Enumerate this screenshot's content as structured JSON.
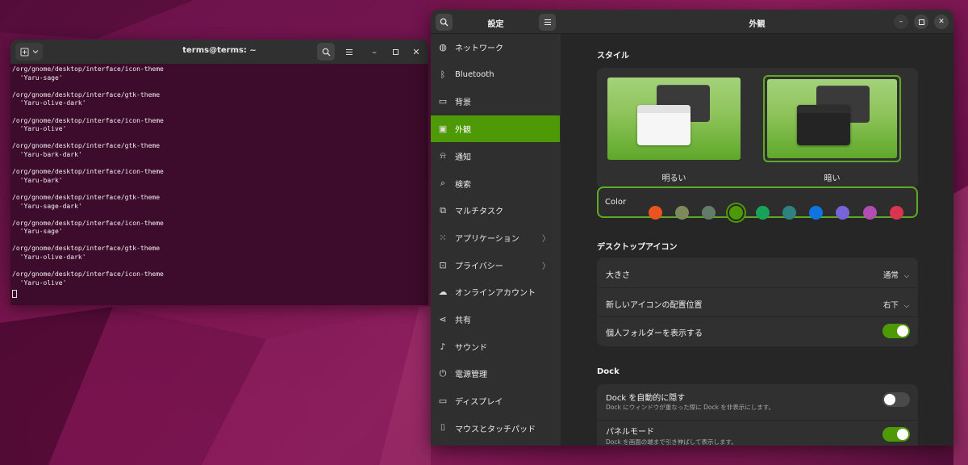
{
  "terminal": {
    "title": "terms@terms: ~",
    "lines": [
      "/org/gnome/desktop/interface/icon-theme",
      "  'Yaru-sage'",
      "",
      "/org/gnome/desktop/interface/gtk-theme",
      "  'Yaru-olive-dark'",
      "",
      "/org/gnome/desktop/interface/icon-theme",
      "  'Yaru-olive'",
      "",
      "/org/gnome/desktop/interface/gtk-theme",
      "  'Yaru-bark-dark'",
      "",
      "/org/gnome/desktop/interface/icon-theme",
      "  'Yaru-bark'",
      "",
      "/org/gnome/desktop/interface/gtk-theme",
      "  'Yaru-sage-dark'",
      "",
      "/org/gnome/desktop/interface/icon-theme",
      "  'Yaru-sage'",
      "",
      "/org/gnome/desktop/interface/gtk-theme",
      "  'Yaru-olive-dark'",
      "",
      "/org/gnome/desktop/interface/icon-theme",
      "  'Yaru-olive'"
    ]
  },
  "settings": {
    "sidebar_title": "設定",
    "page_title": "外観",
    "sidebar": [
      {
        "label": "ネットワーク",
        "icon": "network-icon"
      },
      {
        "label": "Bluetooth",
        "icon": "bluetooth-icon"
      },
      {
        "label": "背景",
        "icon": "background-icon"
      },
      {
        "label": "外観",
        "icon": "appearance-icon",
        "active": true
      },
      {
        "label": "通知",
        "icon": "bell-icon"
      },
      {
        "label": "検索",
        "icon": "search-icon"
      },
      {
        "label": "マルチタスク",
        "icon": "multitasking-icon"
      },
      {
        "label": "アプリケーション",
        "icon": "apps-grid-icon",
        "chevron": true
      },
      {
        "label": "プライバシー",
        "icon": "lock-icon",
        "chevron": true
      },
      {
        "label": "オンラインアカウント",
        "icon": "cloud-icon"
      },
      {
        "label": "共有",
        "icon": "share-icon"
      },
      {
        "label": "サウンド",
        "icon": "music-note-icon"
      },
      {
        "label": "電源管理",
        "icon": "power-icon"
      },
      {
        "label": "ディスプレイ",
        "icon": "display-icon"
      },
      {
        "label": "マウスとタッチパッド",
        "icon": "mouse-icon"
      }
    ],
    "style": {
      "heading": "スタイル",
      "light_label": "明るい",
      "dark_label": "暗い",
      "selected": "dark"
    },
    "color": {
      "label": "Color",
      "swatches": [
        "#e95420",
        "#7e8a5c",
        "#657b69",
        "#4e9a06",
        "#18a35a",
        "#308280",
        "#0f73e0",
        "#7764d8",
        "#b34cb3",
        "#da3450"
      ],
      "selected_index": 3
    },
    "desktop_icons": {
      "heading": "デスクトップアイコン",
      "size_label": "大きさ",
      "size_value": "通常",
      "position_label": "新しいアイコンの配置位置",
      "position_value": "右下",
      "home_label": "個人フォルダーを表示する",
      "home_enabled": true
    },
    "dock": {
      "heading": "Dock",
      "autohide_label": "Dock を自動的に隠す",
      "autohide_sub": "Dock にウィンドウが重なった際に Dock を非表示にします。",
      "autohide_enabled": false,
      "panel_label": "パネルモード",
      "panel_sub": "Dock を画面の端まで引き伸ばして表示します。",
      "panel_enabled": true
    }
  }
}
